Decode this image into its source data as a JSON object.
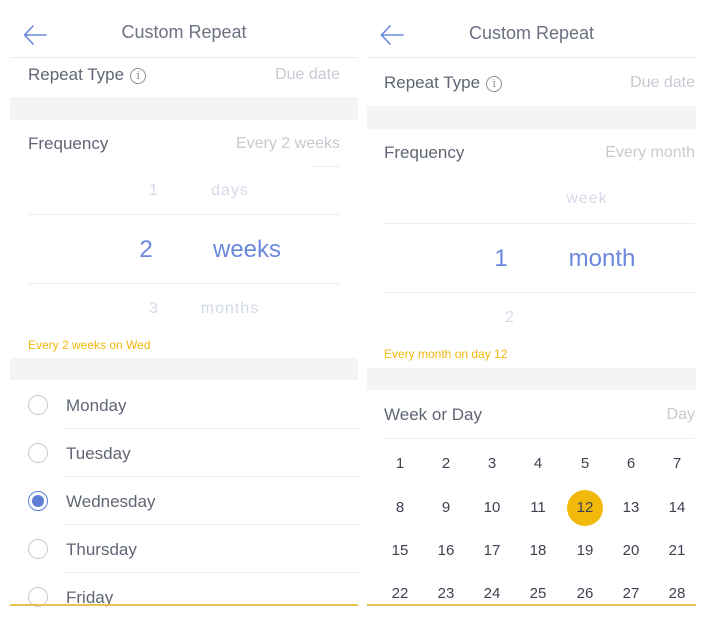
{
  "left": {
    "title": "Custom Repeat",
    "repeat_type_label": "Repeat Type",
    "repeat_type_value": "Due date",
    "frequency_label": "Frequency",
    "frequency_value": "Every 2 weeks",
    "picker": {
      "num_above": "1",
      "unit_above": "days",
      "num_selected": "2",
      "unit_selected": "weeks",
      "num_below": "3",
      "unit_below": "months"
    },
    "summary": "Every 2 weeks on Wed",
    "days": [
      {
        "label": "Monday",
        "checked": false
      },
      {
        "label": "Tuesday",
        "checked": false
      },
      {
        "label": "Wednesday",
        "checked": true
      },
      {
        "label": "Thursday",
        "checked": false
      },
      {
        "label": "Friday",
        "checked": false
      }
    ]
  },
  "right": {
    "title": "Custom Repeat",
    "repeat_type_label": "Repeat Type",
    "repeat_type_value": "Due date",
    "frequency_label": "Frequency",
    "frequency_value": "Every month",
    "picker": {
      "unit_above": "week",
      "num_selected": "1",
      "unit_selected": "month",
      "num_below": "2"
    },
    "summary": "Every month on day 12",
    "week_or_day_label": "Week or Day",
    "week_or_day_value": "Day",
    "calendar_days": [
      "1",
      "2",
      "3",
      "4",
      "5",
      "6",
      "7",
      "8",
      "9",
      "10",
      "11",
      "12",
      "13",
      "14",
      "15",
      "16",
      "17",
      "18",
      "19",
      "20",
      "21",
      "22",
      "23",
      "24",
      "25",
      "26",
      "27",
      "28"
    ],
    "selected_day": "12"
  },
  "colors": {
    "accent_blue": "#6b88dd",
    "accent_yellow": "#f2b90c",
    "summary_yellow": "#f1b70c"
  },
  "icons": {
    "back": "arrow-left-icon",
    "info": "info-circle-icon"
  }
}
